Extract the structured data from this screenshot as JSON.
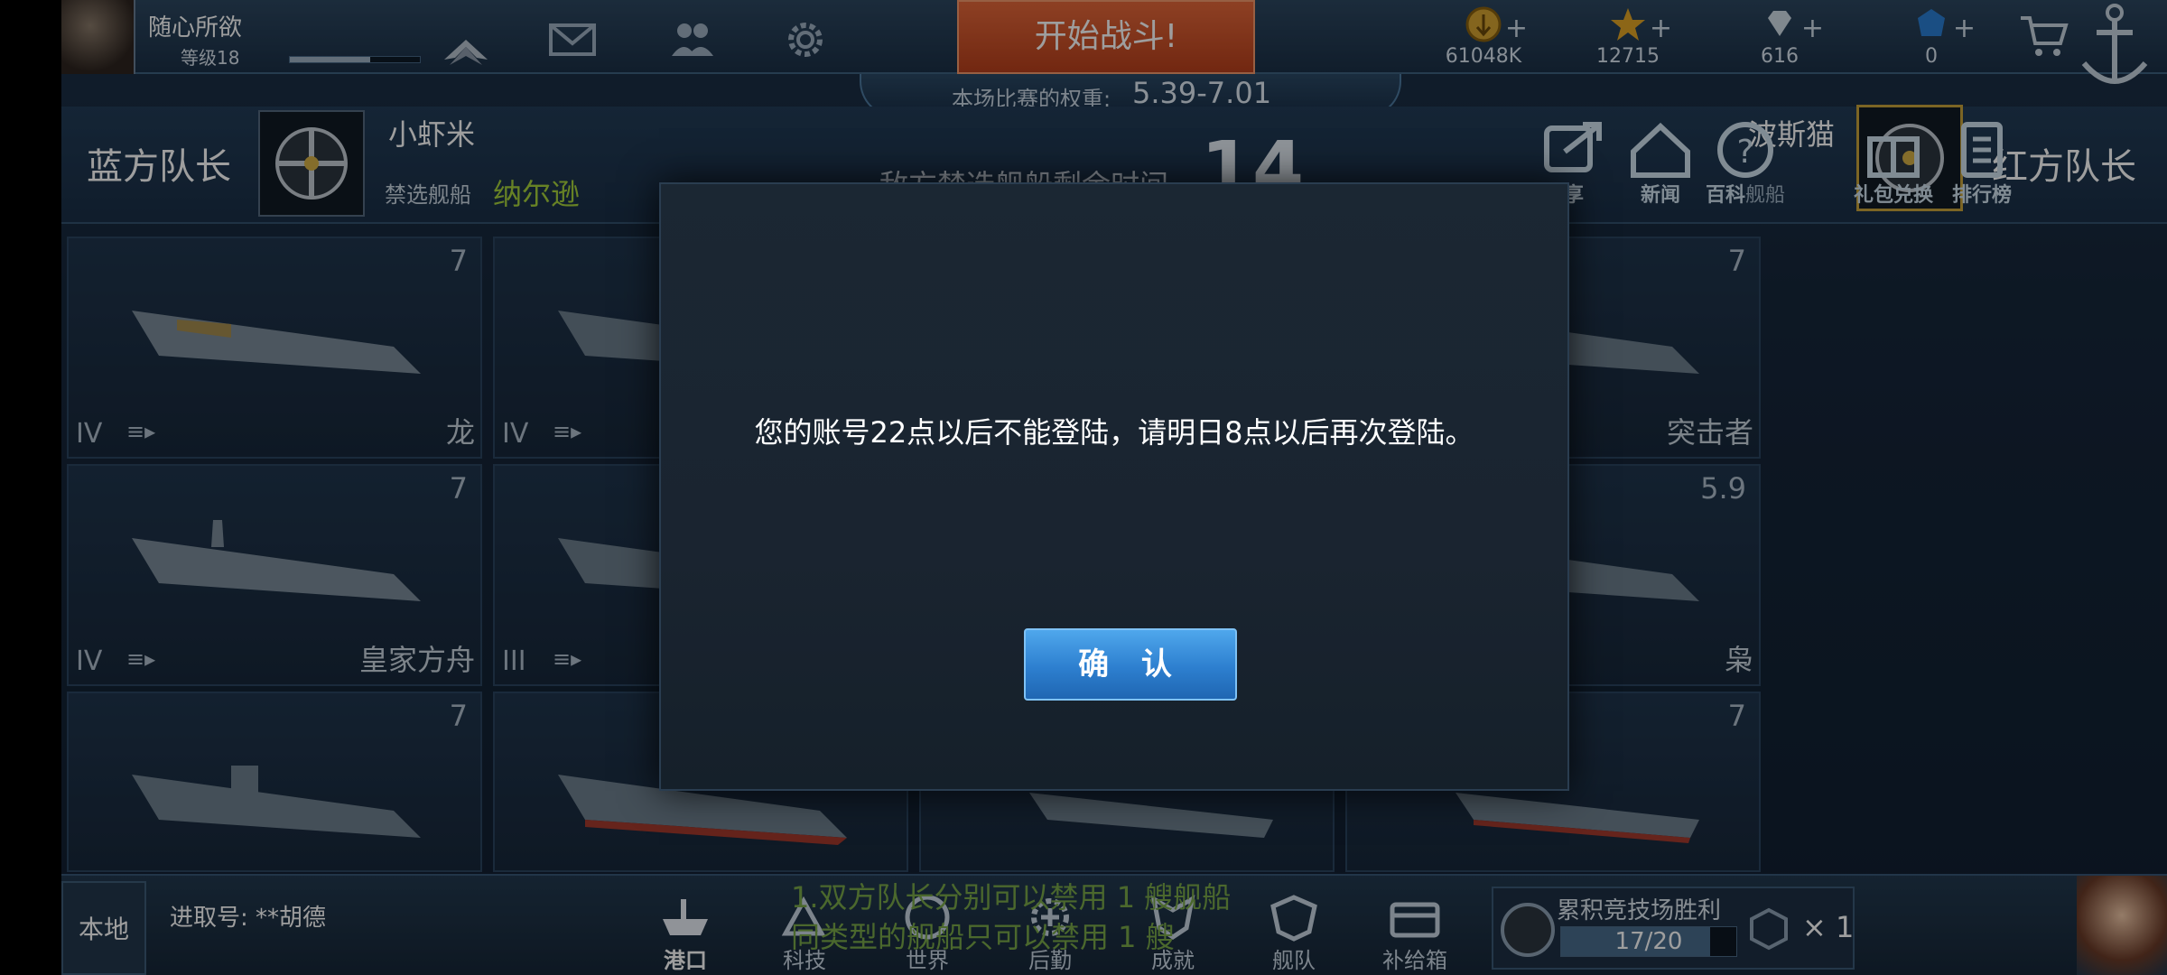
{
  "player": {
    "name": "随心所欲",
    "level": "等级18"
  },
  "header": {
    "start_battle": "开始战斗!",
    "weight_label": "本场比赛的权重:",
    "weight_value": "5.39-7.01",
    "resources": [
      {
        "icon": "gold-coin-icon",
        "value": "61048K"
      },
      {
        "icon": "star-icon",
        "value": "12715"
      },
      {
        "icon": "diamond-icon",
        "value": "616"
      },
      {
        "icon": "blue-gem-icon",
        "value": "0"
      }
    ]
  },
  "captains": {
    "blue_label": "蓝方队长",
    "blue_name": "小虾米",
    "ban_label": "禁选舰船",
    "ban_ship": "纳尔逊",
    "enemy_time_label": "敌方禁选舰船剩余时间",
    "enemy_time_value": "14",
    "red_name": "波斯猫",
    "red_label": "红方队长"
  },
  "side_buttons": [
    "享",
    "新闻",
    "百科",
    "舰船",
    "礼包兑换",
    "排行榜"
  ],
  "ships": [
    {
      "tier": "7",
      "class": "IV",
      "name": "龙"
    },
    {
      "tier": "",
      "class": "IV",
      "name": ""
    },
    {
      "tier": "7",
      "class": "",
      "name": "突击者"
    },
    {
      "tier": "7",
      "class": "IV",
      "name": "皇家方舟"
    },
    {
      "tier": "",
      "class": "III",
      "name": ""
    },
    {
      "tier": "5.9",
      "class": "",
      "name": "枭"
    },
    {
      "tier": "7",
      "class": "",
      "name": ""
    },
    {
      "tier": "",
      "class": "",
      "name": ""
    },
    {
      "tier": "7",
      "class": "",
      "name": ""
    }
  ],
  "bottom": {
    "local": "本地",
    "chat_message": "进取号: **胡德",
    "nav": [
      "港口",
      "科技",
      "世界",
      "后勤",
      "成就",
      "舰队",
      "补给箱"
    ],
    "tip": "1.双方队长分别可以禁用 1 艘舰船\n同类型的舰船只可以禁用 1 艘",
    "wins_label": "累积竞技场胜利",
    "wins_progress": "17/20",
    "wins_fraction": 0.85,
    "multiplier": "× 1"
  },
  "dialog": {
    "message": "您的账号22点以后不能登陆，请明日8点以后再次登陆。",
    "confirm": "确 认"
  }
}
